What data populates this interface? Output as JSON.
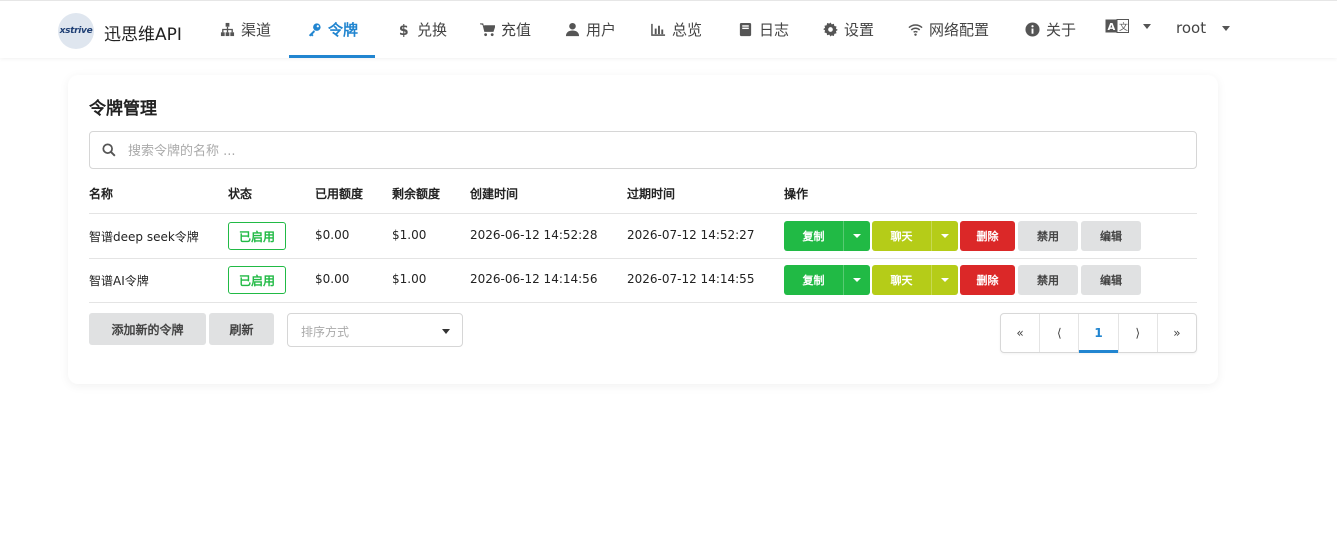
{
  "header": {
    "logo_text": "xstrive",
    "brand": "迅思维API",
    "nav": [
      {
        "label": "渠道",
        "icon": "sitemap-icon"
      },
      {
        "label": "令牌",
        "icon": "key-icon",
        "active": true
      },
      {
        "label": "兑换",
        "icon": "dollar-icon"
      },
      {
        "label": "充值",
        "icon": "cart-icon"
      },
      {
        "label": "用户",
        "icon": "user-icon"
      },
      {
        "label": "总览",
        "icon": "bar-chart-icon"
      },
      {
        "label": "日志",
        "icon": "book-icon"
      },
      {
        "label": "设置",
        "icon": "gear-icon"
      },
      {
        "label": "网络配置",
        "icon": "wifi-icon"
      },
      {
        "label": "关于",
        "icon": "info-icon"
      }
    ],
    "user": "root"
  },
  "page": {
    "title": "令牌管理",
    "search_placeholder": "搜索令牌的名称 ..."
  },
  "table": {
    "columns": [
      "名称",
      "状态",
      "已用额度",
      "剩余额度",
      "创建时间",
      "过期时间",
      "操作"
    ],
    "rows": [
      {
        "name": "智谱deep seek令牌",
        "status": "已启用",
        "used": "$0.00",
        "remaining": "$1.00",
        "created": "2026-06-12 14:52:28",
        "expires": "2026-07-12 14:52:27"
      },
      {
        "name": "智谱AI令牌",
        "status": "已启用",
        "used": "$0.00",
        "remaining": "$1.00",
        "created": "2026-06-12 14:14:56",
        "expires": "2026-07-12 14:14:55"
      }
    ],
    "actions": {
      "copy": "复制",
      "chat": "聊天",
      "delete": "删除",
      "disable": "禁用",
      "edit": "编辑"
    }
  },
  "footer": {
    "add_label": "添加新的令牌",
    "refresh_label": "刷新",
    "sort_placeholder": "排序方式",
    "pagination": {
      "first": "«",
      "prev": "⟨",
      "current": "1",
      "next": "⟩",
      "last": "»"
    }
  },
  "colors": {
    "accent": "#2185d0",
    "green": "#21ba45",
    "olive": "#b5cc18",
    "red": "#db2828",
    "grey": "#e0e1e2"
  }
}
